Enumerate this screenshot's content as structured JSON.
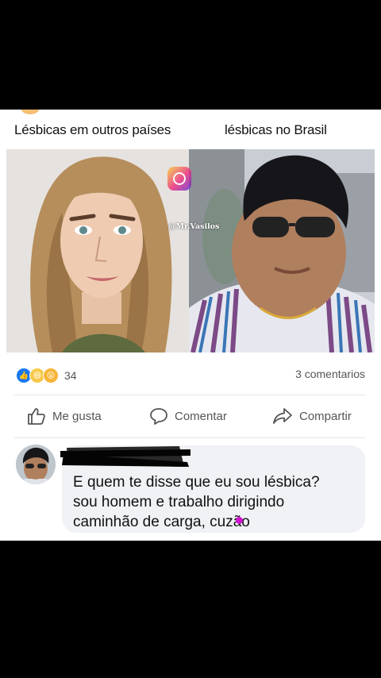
{
  "post": {
    "caption_left": "Lésbicas em outros países",
    "caption_right": "lésbicas no Brasil",
    "watermark": "@Mr.Vasilos"
  },
  "reactions": {
    "count": "34",
    "comments": "3 comentarios",
    "icons": [
      "like-icon",
      "haha-icon",
      "wow-icon"
    ]
  },
  "actions": {
    "like": "Me gusta",
    "comment": "Comentar",
    "share": "Compartir"
  },
  "comment": {
    "text": "E quem te disse que eu sou lésbica?\nsou homem e trabalho dirigindo\ncaminhão de carga, cuzão"
  },
  "colors": {
    "accent": "#1877f2",
    "text_secondary": "#555555",
    "bubble": "#f0f2f5",
    "background": "#000000"
  }
}
